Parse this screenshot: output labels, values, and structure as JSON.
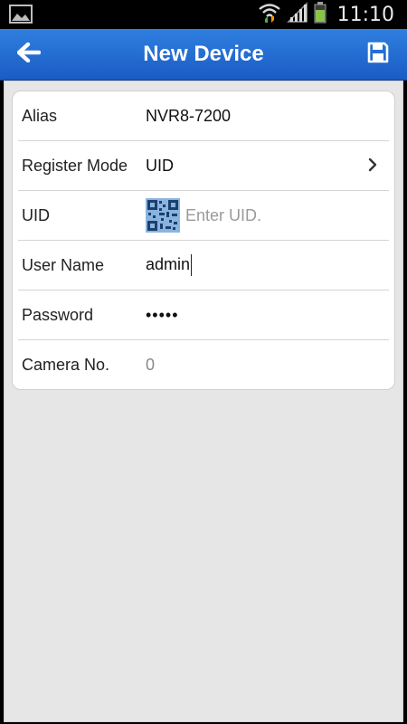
{
  "status_bar": {
    "time": "11:10",
    "left_icon": "image-notification-icon",
    "icons": [
      "wifi-icon",
      "signal-icon",
      "battery-icon"
    ]
  },
  "action_bar": {
    "title": "New Device",
    "back_icon": "back-arrow-icon",
    "save_icon": "save-disk-icon"
  },
  "form": {
    "alias_label": "Alias",
    "alias_value": "NVR8-7200",
    "register_mode_label": "Register Mode",
    "register_mode_value": "UID",
    "uid_label": "UID",
    "uid_placeholder": "Enter UID.",
    "user_name_label": "User Name",
    "user_name_value": "admin",
    "password_label": "Password",
    "password_value": "•••••",
    "camera_no_label": "Camera No.",
    "camera_no_value": "0"
  },
  "colors": {
    "action_bar": "#2f7fe0",
    "background": "#e6e6e6",
    "card": "#ffffff",
    "qr": "#4a86c8"
  }
}
